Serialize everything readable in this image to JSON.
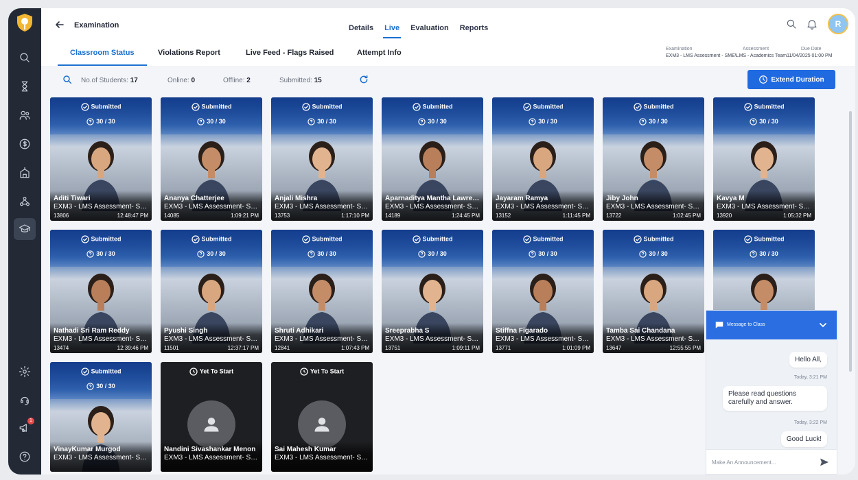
{
  "header": {
    "title": "Examination",
    "tabs": [
      {
        "label": "Details",
        "active": false
      },
      {
        "label": "Live",
        "active": true
      },
      {
        "label": "Evaluation",
        "active": false
      },
      {
        "label": "Reports",
        "active": false
      }
    ],
    "avatar_initial": "R"
  },
  "subtabs": [
    {
      "label": "Classroom Status",
      "active": true
    },
    {
      "label": "Violations Report",
      "active": false
    },
    {
      "label": "Live Feed - Flags Raised",
      "active": false
    },
    {
      "label": "Attempt Info",
      "active": false
    }
  ],
  "meta": {
    "examination_label": "Examination",
    "assessment_label": "Assessment",
    "due_label": "Due Date",
    "value": "EXM3 - LMS Assessment - SME\\LMS - Academics Team11/04/2025 01:00 PM"
  },
  "stats": {
    "students_label": "No.of Students:",
    "students": "17",
    "online_label": "Online:",
    "online": "0",
    "offline_label": "Offline:",
    "offline": "2",
    "submitted_label": "Submitted:",
    "submitted": "15"
  },
  "extend_label": "Extend Duration",
  "cards": [
    {
      "status": "Submitted",
      "score": "30 / 30",
      "name": "Aditi Tiwari",
      "assessment": "EXM3 - LMS Assessment- SME",
      "id": "13806",
      "time": "12:48:47 PM"
    },
    {
      "status": "Submitted",
      "score": "30 / 30",
      "name": "Ananya Chatterjee",
      "assessment": "EXM3 - LMS Assessment- SME",
      "id": "14085",
      "time": "1:09:21 PM"
    },
    {
      "status": "Submitted",
      "score": "30 / 30",
      "name": "Anjali Mishra",
      "assessment": "EXM3 - LMS Assessment- SME",
      "id": "13753",
      "time": "1:17:10 PM"
    },
    {
      "status": "Submitted",
      "score": "30 / 30",
      "name": "Aparnaditya Mantha Lawrence",
      "assessment": "EXM3 - LMS Assessment- SME",
      "id": "14189",
      "time": "1:24:45 PM"
    },
    {
      "status": "Submitted",
      "score": "30 / 30",
      "name": "Jayaram Ramya",
      "assessment": "EXM3 - LMS Assessment- SME",
      "id": "13152",
      "time": "1:11:45 PM"
    },
    {
      "status": "Submitted",
      "score": "30 / 30",
      "name": "Jiby John",
      "assessment": "EXM3 - LMS Assessment- SME",
      "id": "13722",
      "time": "1:02:45 PM"
    },
    {
      "status": "Submitted",
      "score": "30 / 30",
      "name": "Kavya M",
      "assessment": "EXM3 - LMS Assessment- SME",
      "id": "13920",
      "time": "1:05:32 PM"
    },
    {
      "status": "Submitted",
      "score": "30 / 30",
      "name": "Nathadi Sri Ram Reddy",
      "assessment": "EXM3 - LMS Assessment- SME",
      "id": "13474",
      "time": "12:39:46 PM"
    },
    {
      "status": "Submitted",
      "score": "30 / 30",
      "name": "Pyushi Singh",
      "assessment": "EXM3 - LMS Assessment- SME",
      "id": "11501",
      "time": "12:37:17 PM"
    },
    {
      "status": "Submitted",
      "score": "30 / 30",
      "name": "Shruti Adhikari",
      "assessment": "EXM3 - LMS Assessment- SME",
      "id": "12841",
      "time": "1:07:43 PM"
    },
    {
      "status": "Submitted",
      "score": "30 / 30",
      "name": "Sreeprabha S",
      "assessment": "EXM3 - LMS Assessment- SME",
      "id": "13751",
      "time": "1:09:11 PM"
    },
    {
      "status": "Submitted",
      "score": "30 / 30",
      "name": "Stiffna Figarado",
      "assessment": "EXM3 - LMS Assessment- SME",
      "id": "13771",
      "time": "1:01:09 PM"
    },
    {
      "status": "Submitted",
      "score": "30 / 30",
      "name": "Tamba Sai Chandana",
      "assessment": "EXM3 - LMS Assessment- SME",
      "id": "13647",
      "time": "12:55:55 PM"
    },
    {
      "status": "Submitted",
      "score": "30 / 30",
      "name": "",
      "assessment": "",
      "id": "",
      "time": ""
    },
    {
      "status": "Submitted",
      "score": "30 / 30",
      "name": "VinayKumar Murgod",
      "assessment": "EXM3 - LMS Assessment- SME",
      "id": "",
      "time": ""
    },
    {
      "status": "Yet To Start",
      "score": "",
      "name": "Nandini Sivashankar Menon",
      "assessment": "EXM3 - LMS Assessment- SME",
      "id": "",
      "time": ""
    },
    {
      "status": "Yet To Start",
      "score": "",
      "name": "Sai Mahesh Kumar",
      "assessment": "EXM3 - LMS Assessment- SME",
      "id": "",
      "time": ""
    }
  ],
  "chat": {
    "title": "Message to Class",
    "messages": [
      {
        "text": "Hello All,",
        "time": "Today, 3:21 PM"
      },
      {
        "text": "Please read questions carefully and answer.",
        "time": "Today, 3:22 PM"
      },
      {
        "text": "Good Luck!",
        "time": ""
      }
    ],
    "placeholder": "Make An Announcement..."
  },
  "colors": {
    "accent": "#1a6fd1",
    "sidebar": "#232a36",
    "button": "#1f6ae0"
  }
}
